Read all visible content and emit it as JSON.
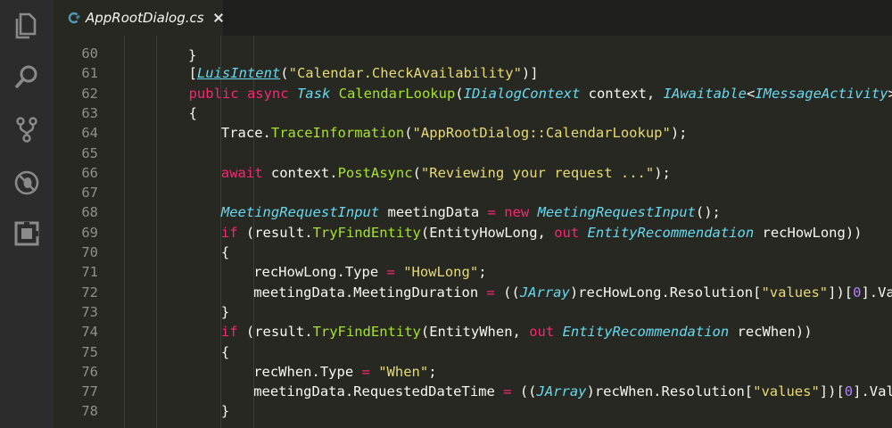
{
  "theme": {
    "background": "#272822",
    "activity_bar": "#2c2c2c",
    "tab_strip": "#1e1f1c"
  },
  "activity_bar": {
    "icons": [
      "explorer-icon",
      "search-icon",
      "source-control-icon",
      "debug-icon",
      "extensions-icon"
    ]
  },
  "tab": {
    "file_icon": "csharp-file-icon",
    "label": "AppRootDialog.cs",
    "close_icon": "close-icon"
  },
  "editor": {
    "top_partial": "}",
    "lines": [
      {
        "n": "60",
        "indent": 0,
        "tokens": []
      },
      {
        "n": "61",
        "indent": 2,
        "tokens": [
          [
            "plain",
            "["
          ],
          [
            "attr",
            "LuisIntent"
          ],
          [
            "plain",
            "("
          ],
          [
            "str",
            "\"Calendar.CheckAvailability\""
          ],
          [
            "plain",
            ")]"
          ]
        ]
      },
      {
        "n": "62",
        "indent": 2,
        "tokens": [
          [
            "kw",
            "public"
          ],
          [
            "plain",
            " "
          ],
          [
            "kw",
            "async"
          ],
          [
            "plain",
            " "
          ],
          [
            "type",
            "Task"
          ],
          [
            "plain",
            " "
          ],
          [
            "func",
            "CalendarLookup"
          ],
          [
            "plain",
            "("
          ],
          [
            "type",
            "IDialogContext"
          ],
          [
            "plain",
            " context, "
          ],
          [
            "type",
            "IAwaitable"
          ],
          [
            "plain",
            "<"
          ],
          [
            "type",
            "IMessageActivity"
          ],
          [
            "plain",
            "> a"
          ]
        ]
      },
      {
        "n": "63",
        "indent": 2,
        "tokens": [
          [
            "plain",
            "{"
          ]
        ]
      },
      {
        "n": "64",
        "indent": 3,
        "tokens": [
          [
            "plain",
            "Trace."
          ],
          [
            "func",
            "TraceInformation"
          ],
          [
            "plain",
            "("
          ],
          [
            "str",
            "\"AppRootDialog::CalendarLookup\""
          ],
          [
            "plain",
            ");"
          ]
        ]
      },
      {
        "n": "65",
        "indent": 0,
        "tokens": []
      },
      {
        "n": "66",
        "indent": 3,
        "tokens": [
          [
            "kw",
            "await"
          ],
          [
            "plain",
            " context."
          ],
          [
            "func",
            "PostAsync"
          ],
          [
            "plain",
            "("
          ],
          [
            "str",
            "\"Reviewing your request ...\""
          ],
          [
            "plain",
            ");"
          ]
        ]
      },
      {
        "n": "67",
        "indent": 0,
        "tokens": []
      },
      {
        "n": "68",
        "indent": 3,
        "tokens": [
          [
            "type",
            "MeetingRequestInput"
          ],
          [
            "plain",
            " meetingData "
          ],
          [
            "kw",
            "="
          ],
          [
            "plain",
            " "
          ],
          [
            "kw",
            "new"
          ],
          [
            "plain",
            " "
          ],
          [
            "type",
            "MeetingRequestInput"
          ],
          [
            "plain",
            "();"
          ]
        ]
      },
      {
        "n": "69",
        "indent": 3,
        "tokens": [
          [
            "kw",
            "if"
          ],
          [
            "plain",
            " (result."
          ],
          [
            "func",
            "TryFindEntity"
          ],
          [
            "plain",
            "(EntityHowLong, "
          ],
          [
            "kw",
            "out"
          ],
          [
            "plain",
            " "
          ],
          [
            "type",
            "EntityRecommendation"
          ],
          [
            "plain",
            " recHowLong))"
          ]
        ]
      },
      {
        "n": "70",
        "indent": 3,
        "tokens": [
          [
            "plain",
            "{"
          ]
        ]
      },
      {
        "n": "71",
        "indent": 4,
        "tokens": [
          [
            "plain",
            "recHowLong.Type "
          ],
          [
            "kw",
            "="
          ],
          [
            "plain",
            " "
          ],
          [
            "str",
            "\"HowLong\""
          ],
          [
            "plain",
            ";"
          ]
        ]
      },
      {
        "n": "72",
        "indent": 4,
        "tokens": [
          [
            "plain",
            "meetingData.MeetingDuration "
          ],
          [
            "kw",
            "="
          ],
          [
            "plain",
            " (("
          ],
          [
            "type",
            "JArray"
          ],
          [
            "plain",
            ")recHowLong.Resolution["
          ],
          [
            "str",
            "\"values\""
          ],
          [
            "plain",
            "])["
          ],
          [
            "num",
            "0"
          ],
          [
            "plain",
            "].Valu"
          ]
        ]
      },
      {
        "n": "73",
        "indent": 3,
        "tokens": [
          [
            "plain",
            "}"
          ]
        ]
      },
      {
        "n": "74",
        "indent": 3,
        "tokens": [
          [
            "kw",
            "if"
          ],
          [
            "plain",
            " (result."
          ],
          [
            "func",
            "TryFindEntity"
          ],
          [
            "plain",
            "(EntityWhen, "
          ],
          [
            "kw",
            "out"
          ],
          [
            "plain",
            " "
          ],
          [
            "type",
            "EntityRecommendation"
          ],
          [
            "plain",
            " recWhen))"
          ]
        ]
      },
      {
        "n": "75",
        "indent": 3,
        "tokens": [
          [
            "plain",
            "{"
          ]
        ]
      },
      {
        "n": "76",
        "indent": 4,
        "tokens": [
          [
            "plain",
            "recWhen.Type "
          ],
          [
            "kw",
            "="
          ],
          [
            "plain",
            " "
          ],
          [
            "str",
            "\"When\""
          ],
          [
            "plain",
            ";"
          ]
        ]
      },
      {
        "n": "77",
        "indent": 4,
        "tokens": [
          [
            "plain",
            "meetingData.RequestedDateTime "
          ],
          [
            "kw",
            "="
          ],
          [
            "plain",
            " (("
          ],
          [
            "type",
            "JArray"
          ],
          [
            "plain",
            ")recWhen.Resolution["
          ],
          [
            "str",
            "\"values\""
          ],
          [
            "plain",
            "])["
          ],
          [
            "num",
            "0"
          ],
          [
            "plain",
            "].Value"
          ]
        ]
      },
      {
        "n": "78",
        "indent": 3,
        "tokens": [
          [
            "plain",
            "}"
          ]
        ]
      }
    ]
  }
}
